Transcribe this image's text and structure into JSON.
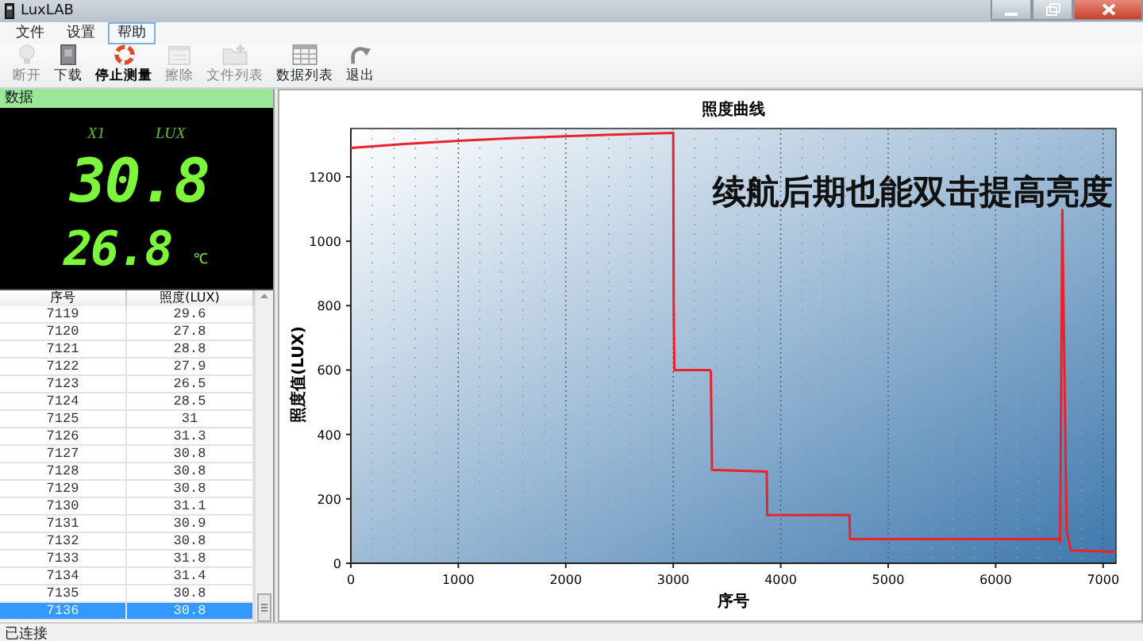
{
  "window": {
    "title": "LuxLAB"
  },
  "menu": [
    {
      "label": "文件",
      "selected": false
    },
    {
      "label": "设置",
      "selected": false
    },
    {
      "label": "帮助",
      "selected": true
    }
  ],
  "toolbar": [
    {
      "label": "断开",
      "disabled": true,
      "active": false
    },
    {
      "label": "下载",
      "disabled": false,
      "active": false
    },
    {
      "label": "停止测量",
      "disabled": false,
      "active": true
    },
    {
      "label": "擦除",
      "disabled": true,
      "active": false
    },
    {
      "label": "文件列表",
      "disabled": true,
      "active": false
    },
    {
      "label": "数据列表",
      "disabled": false,
      "active": false
    },
    {
      "label": "退出",
      "disabled": false,
      "active": false
    }
  ],
  "data_panel": {
    "title": "数据",
    "display": {
      "channel": "X1",
      "unit": "LUX",
      "value": "30.8",
      "temperature": "26.8",
      "temperature_unit": "℃"
    },
    "table": {
      "columns": [
        "序号",
        "照度(LUX)"
      ],
      "rows": [
        {
          "cells": [
            "7119",
            "29.6"
          ],
          "selected": false
        },
        {
          "cells": [
            "7120",
            "27.8"
          ],
          "selected": false
        },
        {
          "cells": [
            "7121",
            "28.8"
          ],
          "selected": false
        },
        {
          "cells": [
            "7122",
            "27.9"
          ],
          "selected": false
        },
        {
          "cells": [
            "7123",
            "26.5"
          ],
          "selected": false
        },
        {
          "cells": [
            "7124",
            "28.5"
          ],
          "selected": false
        },
        {
          "cells": [
            "7125",
            "31"
          ],
          "selected": false
        },
        {
          "cells": [
            "7126",
            "31.3"
          ],
          "selected": false
        },
        {
          "cells": [
            "7127",
            "30.8"
          ],
          "selected": false
        },
        {
          "cells": [
            "7128",
            "30.8"
          ],
          "selected": false
        },
        {
          "cells": [
            "7129",
            "30.8"
          ],
          "selected": false
        },
        {
          "cells": [
            "7130",
            "31.1"
          ],
          "selected": false
        },
        {
          "cells": [
            "7131",
            "30.9"
          ],
          "selected": false
        },
        {
          "cells": [
            "7132",
            "30.8"
          ],
          "selected": false
        },
        {
          "cells": [
            "7133",
            "31.8"
          ],
          "selected": false
        },
        {
          "cells": [
            "7134",
            "31.4"
          ],
          "selected": false
        },
        {
          "cells": [
            "7135",
            "30.8"
          ],
          "selected": false
        },
        {
          "cells": [
            "7136",
            "30.8"
          ],
          "selected": true
        }
      ]
    }
  },
  "chart_panel": {
    "chart_data": {
      "type": "line",
      "title": "照度曲线",
      "xlabel": "序号",
      "ylabel": "照度值(LUX)",
      "x": [
        0,
        500,
        1000,
        1500,
        2000,
        2500,
        3000,
        3005,
        3010,
        3340,
        3350,
        3360,
        3870,
        3875,
        3880,
        4640,
        4645,
        4650,
        6590,
        6600,
        6620,
        6640,
        6660,
        6700,
        7120
      ],
      "series": [
        {
          "color": "#e8232a",
          "values": [
            1290,
            1302,
            1312,
            1320,
            1326,
            1332,
            1336,
            800,
            600,
            600,
            595,
            290,
            285,
            150,
            150,
            150,
            75,
            75,
            75,
            70,
            1100,
            600,
            100,
            40,
            35
          ]
        }
      ],
      "grid": true,
      "xlim": [
        0,
        7120
      ],
      "ylim": [
        0,
        1350
      ],
      "xticks": [
        0,
        1000,
        2000,
        3000,
        4000,
        5000,
        6000,
        7000
      ],
      "yticks": [
        0,
        200,
        400,
        600,
        800,
        1000,
        1200
      ],
      "annotations": [
        {
          "text": "续航后期也能双击提高亮度"
        }
      ]
    }
  },
  "status_bar": {
    "text": "已连接"
  }
}
